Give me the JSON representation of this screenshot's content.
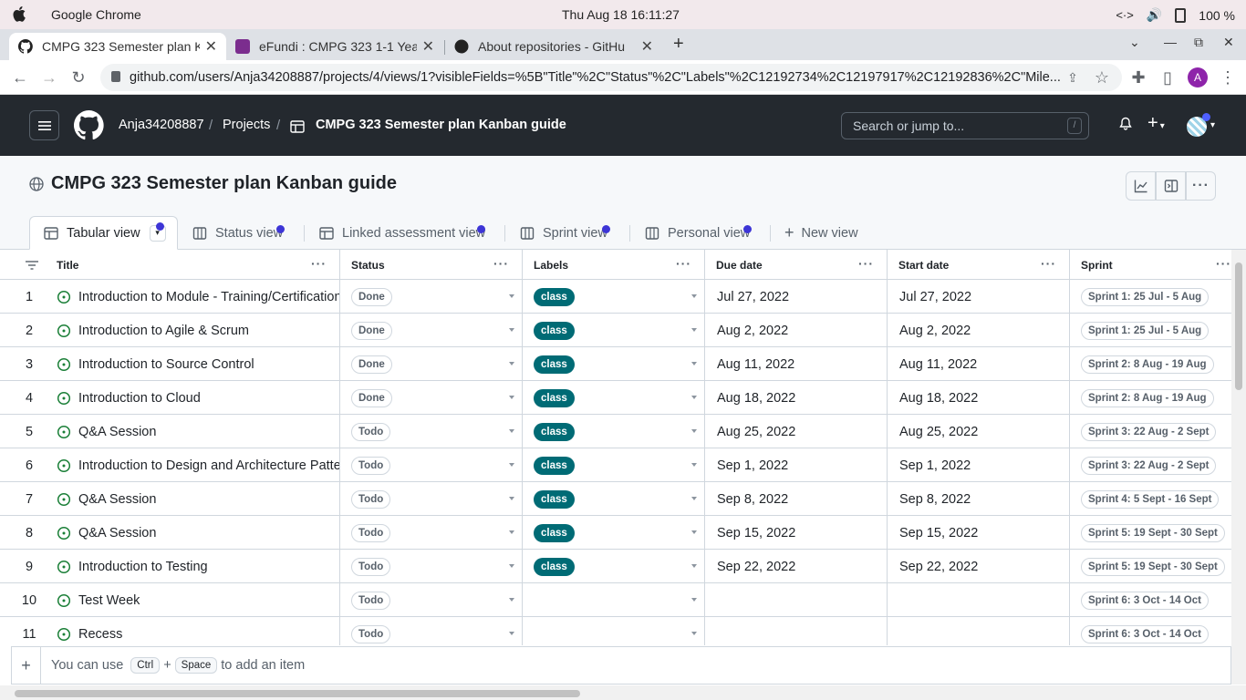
{
  "os": {
    "app_name": "Google Chrome",
    "clock": "Thu Aug 18  16:11:27",
    "battery": "100 %"
  },
  "browser": {
    "tabs": [
      {
        "title": "CMPG 323 Semester plan K"
      },
      {
        "title": "eFundi : CMPG 323 1-1 Yea"
      },
      {
        "title": "About repositories - GitHu"
      }
    ],
    "url": "github.com/users/Anja34208887/projects/4/views/1?visibleFields=%5B\"Title\"%2C\"Status\"%2C\"Labels\"%2C12192734%2C12197917%2C12192836%2C\"Mile...",
    "profile_initial": "A"
  },
  "github_header": {
    "user": "Anja34208887",
    "projects": "Projects",
    "project_title": "CMPG 323 Semester plan Kanban guide",
    "search_placeholder": "Search or jump to...",
    "slash_key": "/"
  },
  "project": {
    "title": "CMPG 323 Semester plan Kanban guide"
  },
  "views": [
    {
      "label": "Tabular view"
    },
    {
      "label": "Status view"
    },
    {
      "label": "Linked assessment view"
    },
    {
      "label": "Sprint view"
    },
    {
      "label": "Personal view"
    },
    {
      "label": "New view"
    }
  ],
  "columns": [
    "Title",
    "Status",
    "Labels",
    "Due date",
    "Start date",
    "Sprint"
  ],
  "rows": [
    {
      "num": "1",
      "title": "Introduction to Module - Training/Certification",
      "status": "Done",
      "label": "class",
      "due": "Jul 27, 2022",
      "start": "Jul 27, 2022",
      "sprint": "Sprint 1: 25 Jul - 5 Aug"
    },
    {
      "num": "2",
      "title": "Introduction to Agile & Scrum",
      "status": "Done",
      "label": "class",
      "due": "Aug 2, 2022",
      "start": "Aug 2, 2022",
      "sprint": "Sprint 1: 25 Jul - 5 Aug"
    },
    {
      "num": "3",
      "title": "Introduction to Source Control",
      "status": "Done",
      "label": "class",
      "due": "Aug 11, 2022",
      "start": "Aug 11, 2022",
      "sprint": "Sprint 2: 8 Aug - 19 Aug"
    },
    {
      "num": "4",
      "title": "Introduction to Cloud",
      "status": "Done",
      "label": "class",
      "due": "Aug 18, 2022",
      "start": "Aug 18, 2022",
      "sprint": "Sprint 2: 8 Aug - 19 Aug"
    },
    {
      "num": "5",
      "title": "Q&A Session",
      "status": "Todo",
      "label": "class",
      "due": "Aug 25, 2022",
      "start": "Aug 25, 2022",
      "sprint": "Sprint 3: 22 Aug - 2 Sept"
    },
    {
      "num": "6",
      "title": "Introduction to Design and Architecture Patterns",
      "status": "Todo",
      "label": "class",
      "due": "Sep 1, 2022",
      "start": "Sep 1, 2022",
      "sprint": "Sprint 3: 22 Aug - 2 Sept"
    },
    {
      "num": "7",
      "title": "Q&A Session",
      "status": "Todo",
      "label": "class",
      "due": "Sep 8, 2022",
      "start": "Sep 8, 2022",
      "sprint": "Sprint 4: 5 Sept - 16 Sept"
    },
    {
      "num": "8",
      "title": "Q&A Session",
      "status": "Todo",
      "label": "class",
      "due": "Sep 15, 2022",
      "start": "Sep 15, 2022",
      "sprint": "Sprint 5: 19 Sept - 30 Sept"
    },
    {
      "num": "9",
      "title": "Introduction to Testing",
      "status": "Todo",
      "label": "class",
      "due": "Sep 22, 2022",
      "start": "Sep 22, 2022",
      "sprint": "Sprint 5: 19 Sept - 30 Sept"
    },
    {
      "num": "10",
      "title": "Test Week",
      "status": "Todo",
      "label": "",
      "due": "",
      "start": "",
      "sprint": "Sprint 6: 3 Oct - 14 Oct"
    },
    {
      "num": "11",
      "title": "Recess",
      "status": "Todo",
      "label": "",
      "due": "",
      "start": "",
      "sprint": "Sprint 6: 3 Oct - 14 Oct"
    }
  ],
  "add_item": {
    "prefix": "You can use",
    "key1": "Ctrl",
    "plus": "+",
    "key2": "Space",
    "suffix": "to add an item"
  },
  "colors": {
    "header_bg": "#24292f",
    "label_class": "#006b75",
    "open_issue": "#1a7f37",
    "view_dot": "#3d35d6"
  }
}
